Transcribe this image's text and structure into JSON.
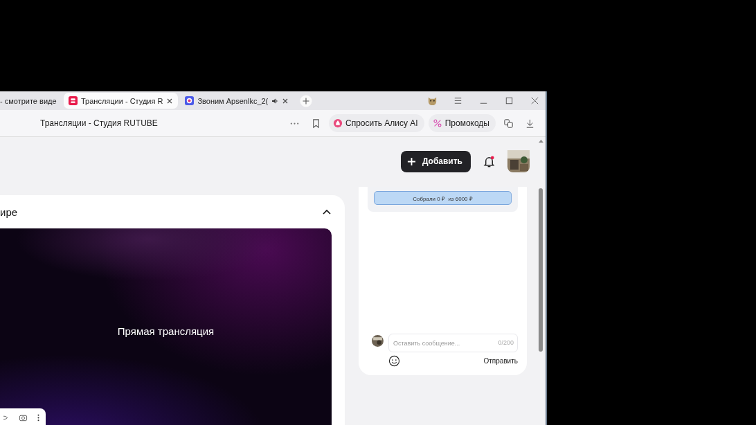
{
  "tabs": [
    {
      "title": "- смотрите виде",
      "selected": false,
      "audio": false,
      "kind": "plain"
    },
    {
      "title": "Трансляции - Студия R",
      "selected": true,
      "audio": false,
      "kind": "video"
    },
    {
      "title": "Звоним Apsenlkc_2(",
      "selected": false,
      "audio": true,
      "kind": "call"
    }
  ],
  "address_bar": {
    "title": "Трансляции - Студия RUTUBE"
  },
  "toolbar": [
    {
      "kind": "alice",
      "label": "Спросить Алису AI"
    },
    {
      "kind": "promo",
      "label": "Промокоды"
    }
  ],
  "header": {
    "add_button": "Добавить",
    "notifications_unread": true
  },
  "stream_card": {
    "title": "ире",
    "expanded": true,
    "video_label": "Прямая трансляция"
  },
  "chat": {
    "donation": {
      "label": "Собрали 0 ₽  из 6000 ₽"
    },
    "message": {
      "placeholder": "Оставить сообщение...",
      "counter": "0/200"
    },
    "send_button": "Отправить"
  }
}
